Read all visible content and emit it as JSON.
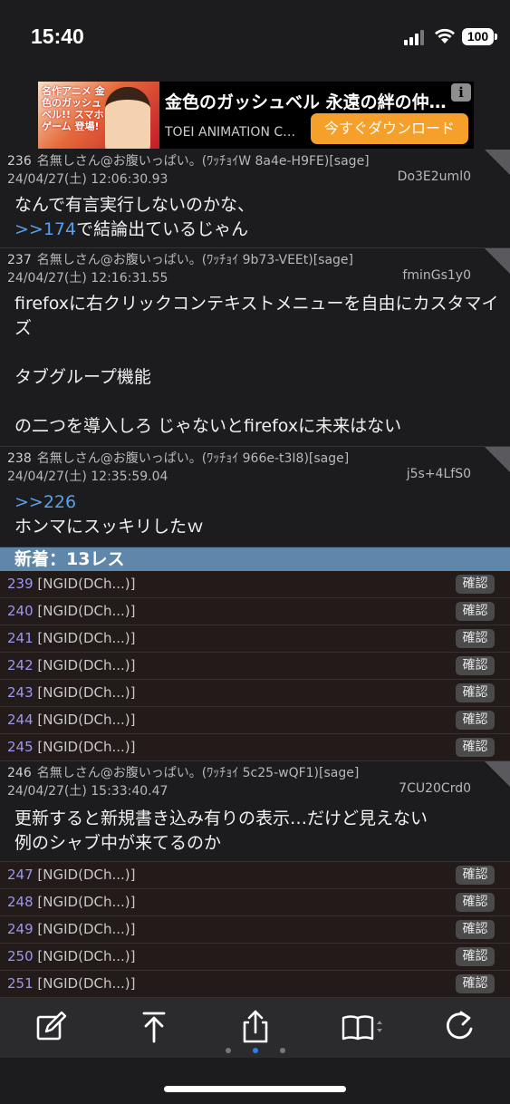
{
  "status": {
    "time": "15:40",
    "battery": "100"
  },
  "ad": {
    "image_text": "名作アニメ 金色のガッシュベル!! スマホゲーム 登場!",
    "title": "金色のガッシュベル 永遠の絆の仲…",
    "advertiser": "TOEI ANIMATION C…",
    "cta": "今すぐダウンロード",
    "info": "i"
  },
  "posts": [
    {
      "num": "236",
      "name": "名無しさん@お腹いっぱい。(ﾜｯﾁｮｲW 8a4e-H9FE)[sage]",
      "date": "24/04/27(土) 12:06:30.93",
      "id": "Do3E2uml0",
      "anchor": ">>174",
      "line1_pre": "なんで有言実行しないのかな、",
      "line2_post": "で結論出ているじゃん"
    },
    {
      "num": "237",
      "name": "名無しさん@お腹いっぱい。(ﾜｯﾁｮｲ 9b73-VEEt)[sage]",
      "date": "24/04/27(土) 12:16:31.55",
      "id": "fminGs1y0",
      "body": "firefoxに右クリックコンテキストメニューを自由にカスタマイズ\n\nタブグループ機能\n\nの二つを導入しろ じゃないとfirefoxに未来はない"
    },
    {
      "num": "238",
      "name": "名無しさん@お腹いっぱい。(ﾜｯﾁｮｲ 966e-t3I8)[sage]",
      "date": "24/04/27(土) 12:35:59.04",
      "id": "j5s+4LfS0",
      "anchor": ">>226",
      "body_after": "ホンマにスッキリしたｗ"
    },
    {
      "num": "246",
      "name": "名無しさん@お腹いっぱい。(ﾜｯﾁｮｲ 5c25-wQF1)[sage]",
      "date": "24/04/27(土) 15:33:40.47",
      "id": "7CU20Crd0",
      "body": "更新すると新規書き込み有りの表示…だけど見えない\n例のシャブ中が来てるのか"
    }
  ],
  "new_bar": "新着：13レス",
  "ng_label": "[NGID(DCh...)]",
  "confirm_label": "確認",
  "ng_rows_a": [
    "239",
    "240",
    "241",
    "242",
    "243",
    "244",
    "245"
  ],
  "ng_rows_b": [
    "247",
    "248",
    "249",
    "250",
    "251"
  ],
  "toolbar": [
    "compose-icon",
    "scroll-top-icon",
    "share-icon",
    "bookmark-book-icon",
    "reload-icon"
  ]
}
